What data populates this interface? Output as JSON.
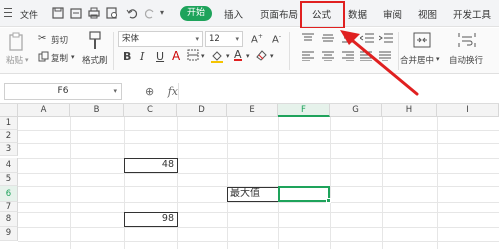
{
  "menubar": {
    "file_label": "文件",
    "home_label": "开始",
    "tabs": [
      "插入",
      "页面布局",
      "公式",
      "数据",
      "审阅",
      "视图",
      "开发工具"
    ]
  },
  "ribbon": {
    "paste_label": "粘贴",
    "cut_label": "剪切",
    "copy_label": "复制",
    "format_painter_label": "格式刷",
    "font_name": "宋体",
    "font_size": "12",
    "merge_center_label": "合并居中",
    "wrap_text_label": "自动换行"
  },
  "formula_bar": {
    "name_box": "F6",
    "fx_label": "fx",
    "formula_value": ""
  },
  "sheet": {
    "columns": [
      "A",
      "B",
      "C",
      "D",
      "E",
      "F",
      "G",
      "H",
      "I"
    ],
    "rows": [
      "1",
      "2",
      "3",
      "4",
      "5",
      "6",
      "7",
      "8",
      "9"
    ],
    "active_column": "F",
    "active_row": "6",
    "cells": {
      "c4": "48",
      "c8": "98",
      "e6": "最大值"
    }
  },
  "colors": {
    "accent_green": "#1ea35b",
    "highlight_red": "#e02020"
  }
}
